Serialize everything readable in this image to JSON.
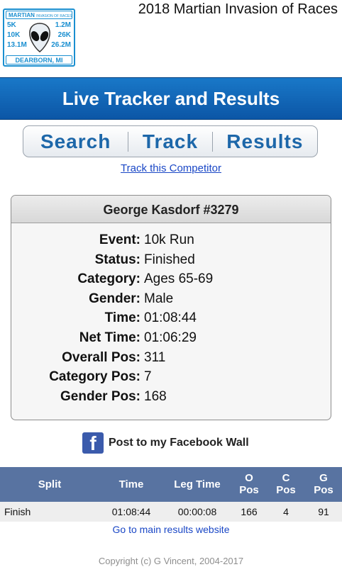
{
  "header": {
    "logo": {
      "top_text": "MARTIAN",
      "top_small": "INVASION OF RACES",
      "dist_left_1": "5K",
      "dist_left_2": "10K",
      "dist_left_3": "13.1M",
      "dist_right_1": "1.2M",
      "dist_right_2": "26K",
      "dist_right_3": "26.2M",
      "bottom_text": "DEARBORN, MI"
    },
    "race_title": "2018 Martian Invasion of Races"
  },
  "banner": {
    "title": "Live Tracker and Results"
  },
  "tabs": {
    "search": "Search",
    "track": "Track",
    "results": "Results"
  },
  "track_link": "Track this Competitor",
  "competitor": {
    "name": "George Kasdorf #3279",
    "fields": [
      {
        "label": "Event:",
        "value": "10k Run"
      },
      {
        "label": "Status:",
        "value": "Finished"
      },
      {
        "label": "Category:",
        "value": "Ages 65-69"
      },
      {
        "label": "Gender:",
        "value": "Male"
      },
      {
        "label": "Time:",
        "value": "01:08:44"
      },
      {
        "label": "Net Time:",
        "value": "01:06:29"
      },
      {
        "label": "Overall Pos:",
        "value": "311"
      },
      {
        "label": "Category Pos:",
        "value": "7"
      },
      {
        "label": "Gender Pos:",
        "value": "168"
      }
    ]
  },
  "facebook": {
    "icon_letter": "f",
    "label": "Post to my Facebook Wall"
  },
  "splits": {
    "headers": {
      "split": "Split",
      "time": "Time",
      "leg_time": "Leg Time",
      "o_pos_1": "O",
      "o_pos_2": "Pos",
      "c_pos_1": "C",
      "c_pos_2": "Pos",
      "g_pos_1": "G",
      "g_pos_2": "Pos"
    },
    "rows": [
      {
        "split": "Finish",
        "time": "01:08:44",
        "leg_time": "00:00:08",
        "o_pos": "166",
        "c_pos": "4",
        "g_pos": "91"
      }
    ]
  },
  "main_link": "Go to main results website",
  "copyright": "Copyright (c) G Vincent, 2004-2017",
  "colors": {
    "banner": "#1570c0",
    "tab_text": "#1d67a9",
    "table_header": "#5873a1",
    "link": "#1a47c6",
    "facebook": "#3b5bac"
  }
}
